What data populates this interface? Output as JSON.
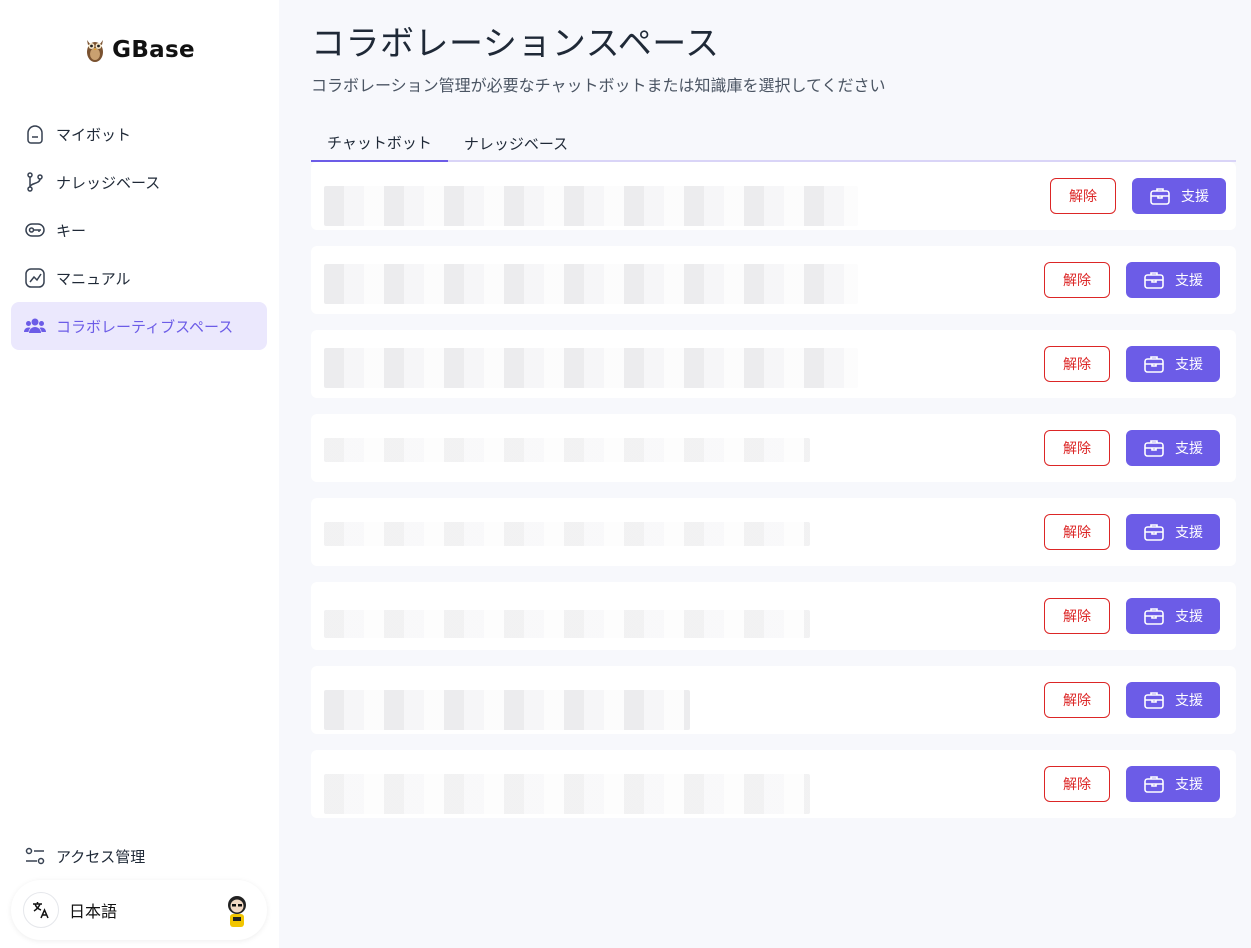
{
  "app": {
    "logo_text": "GBase"
  },
  "sidebar": {
    "items": [
      {
        "label": "マイボット",
        "icon": "bot-icon"
      },
      {
        "label": "ナレッジベース",
        "icon": "branch-icon"
      },
      {
        "label": "キー",
        "icon": "key-icon"
      },
      {
        "label": "マニュアル",
        "icon": "chart-icon"
      },
      {
        "label": "コラボレーティブスペース",
        "icon": "users-icon",
        "active": true
      }
    ],
    "access": {
      "label": "アクセス管理",
      "icon": "settings-sliders-icon"
    },
    "language": {
      "label": "日本語",
      "icon": "translate-icon"
    }
  },
  "main": {
    "title": "コラボレーションスペース",
    "subtitle": "コラボレーション管理が必要なチャットボットまたは知識庫を選択してください",
    "tabs": [
      {
        "label": "チャットボット",
        "active": true
      },
      {
        "label": "ナレッジベース",
        "active": false
      }
    ],
    "row_actions": {
      "remove_label": "解除",
      "support_label": "支援"
    },
    "rows_count": 8
  },
  "colors": {
    "accent": "#6c5ce7",
    "danger": "#dc2626",
    "active_bg": "#ebe8fd"
  }
}
